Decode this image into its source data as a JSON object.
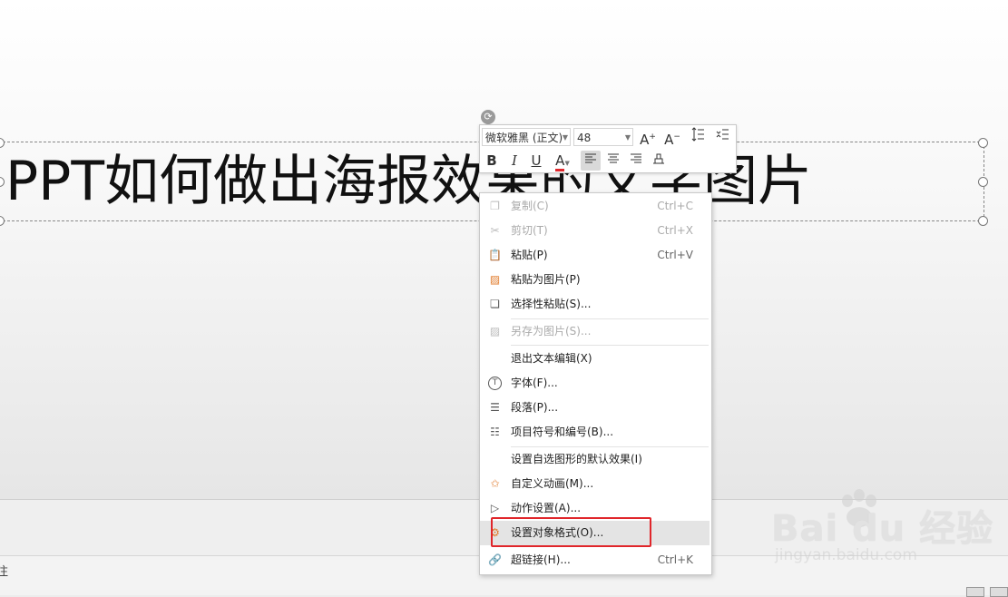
{
  "slide": {
    "title_text": "PPT如何做出海报效果的文字图片",
    "rotate_icon": "rotate-icon"
  },
  "mini_toolbar": {
    "font_name": "微软雅黑 (正文)",
    "font_size": "48",
    "grow_font": "A",
    "shrink_font": "A",
    "bold": "B",
    "italic": "I",
    "underline": "U",
    "font_color": "A",
    "font_color_hex": "#e0262b"
  },
  "context_menu": {
    "items": [
      {
        "label": "复制(C)",
        "shortcut": "Ctrl+C",
        "icon": "copy-icon",
        "disabled": true
      },
      {
        "label": "剪切(T)",
        "shortcut": "Ctrl+X",
        "icon": "cut-icon",
        "disabled": true
      },
      {
        "label": "粘贴(P)",
        "shortcut": "Ctrl+V",
        "icon": "paste-icon",
        "disabled": false
      },
      {
        "label": "粘贴为图片(P)",
        "shortcut": "",
        "icon": "paste-picture-icon",
        "disabled": false
      },
      {
        "label": "选择性粘贴(S)...",
        "shortcut": "",
        "icon": "paste-special-icon",
        "disabled": false
      },
      {
        "label": "另存为图片(S)...",
        "shortcut": "",
        "icon": "save-picture-icon",
        "disabled": true
      },
      {
        "label": "退出文本编辑(X)",
        "shortcut": "",
        "icon": "",
        "disabled": false
      },
      {
        "label": "字体(F)...",
        "shortcut": "",
        "icon": "font-icon",
        "disabled": false
      },
      {
        "label": "段落(P)...",
        "shortcut": "",
        "icon": "paragraph-icon",
        "disabled": false
      },
      {
        "label": "项目符号和编号(B)...",
        "shortcut": "",
        "icon": "bullets-icon",
        "disabled": false
      },
      {
        "label": "设置自选图形的默认效果(I)",
        "shortcut": "",
        "icon": "",
        "disabled": false
      },
      {
        "label": "自定义动画(M)...",
        "shortcut": "",
        "icon": "animation-icon",
        "disabled": false
      },
      {
        "label": "动作设置(A)...",
        "shortcut": "",
        "icon": "action-icon",
        "disabled": false
      },
      {
        "label": "设置对象格式(O)...",
        "shortcut": "",
        "icon": "format-object-icon",
        "disabled": false
      },
      {
        "label": "超链接(H)...",
        "shortcut": "Ctrl+K",
        "icon": "hyperlink-icon",
        "disabled": false
      }
    ]
  },
  "watermark": {
    "brand": "Bai du 经验",
    "url": "jingyan.baidu.com"
  },
  "status": {
    "notes_char": "注"
  },
  "colors": {
    "highlight": "#e0262b",
    "accent_orange": "#e07a2b"
  }
}
